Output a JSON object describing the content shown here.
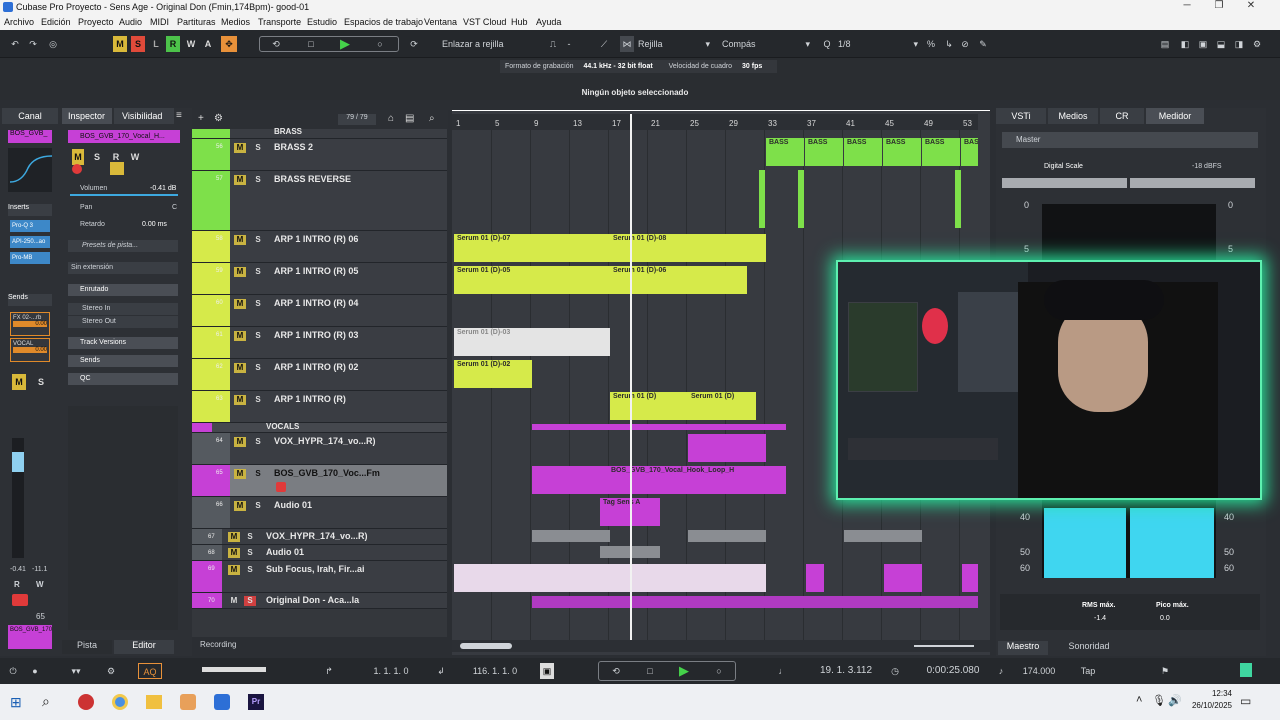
{
  "window": {
    "title": "Cubase Pro Proyecto - Sens Age - Original Don (Fmin,174Bpm)- good-01"
  },
  "menu": [
    "Archivo",
    "Edición",
    "Proyecto",
    "Audio",
    "MIDI",
    "Partituras",
    "Medios",
    "Transporte",
    "Estudio",
    "Espacios de trabajo",
    "Ventana",
    "VST Cloud",
    "Hub",
    "Ayuda"
  ],
  "toolbar": {
    "chips": [
      "M",
      "S",
      "L",
      "R",
      "W",
      "A"
    ],
    "snap_mode": "Enlazar a rejilla",
    "grid_type": "Rejilla",
    "grid_unit": "Compás",
    "quantize": "1/8",
    "dash": "-"
  },
  "infobar": {
    "format_label": "Formato de grabación",
    "format_value": "44.1 kHz - 32 bit float",
    "fps_label": "Velocidad de cuadro",
    "fps_value": "30 fps",
    "selection": "Ningún objeto seleccionado"
  },
  "left": {
    "tab_canal": "Canal",
    "tab_inspector": "Inspector",
    "tab_visibilidad": "Visibilidad",
    "channel_name": "BOS_GVB_",
    "track_name": "BOS_GVB_170_Vocal_H...",
    "volume_label": "Volumen",
    "volume_value": "-0.41 dB",
    "pan_label": "Pan",
    "pan_value": "C",
    "delay_label": "Retardo",
    "delay_value": "0.00 ms",
    "preset": "Presets de pista...",
    "extension": "Sin extensión",
    "routing": "Enrutado",
    "stereo_in": "Stereo In",
    "stereo_out": "Stereo Out",
    "track_versions": "Track Versions",
    "sends": "Sends",
    "qc": "QC",
    "inserts": "Inserts",
    "insert_slots": [
      "Pro-Q 3",
      "API-250...ao",
      "Pro-MB"
    ],
    "sends_title": "Sends",
    "send_slots": [
      {
        "name": "FX 02-...rb",
        "value": "0.00"
      },
      {
        "name": "VOCAL",
        "value": "0.00"
      }
    ],
    "fader_value1": "-0.41",
    "fader_value2": "-11.1",
    "fader_num": "65",
    "bottom_name": "BOS_GVB_170_Vocal_H",
    "tab_pista": "Pista",
    "tab_editor": "Editor"
  },
  "tracklist": {
    "counter": "79 / 79",
    "footer": "Recording",
    "tracks": [
      {
        "num": "",
        "name": "BRASS",
        "color": "#7ee04a"
      },
      {
        "num": "56",
        "name": "BRASS 2",
        "color": "#7ee04a"
      },
      {
        "num": "57",
        "name": "BRASS REVERSE",
        "color": "#7ee04a"
      },
      {
        "num": "58",
        "name": "ARP 1 INTRO (R) 06",
        "color": "#d6ea4a"
      },
      {
        "num": "59",
        "name": "ARP 1 INTRO (R) 05",
        "color": "#d6ea4a"
      },
      {
        "num": "60",
        "name": "ARP 1 INTRO (R) 04",
        "color": "#d6ea4a"
      },
      {
        "num": "61",
        "name": "ARP 1 INTRO (R) 03",
        "color": "#d6ea4a"
      },
      {
        "num": "62",
        "name": "ARP 1 INTRO (R) 02",
        "color": "#d6ea4a"
      },
      {
        "num": "63",
        "name": "ARP 1 INTRO (R)",
        "color": "#d6ea4a"
      },
      {
        "num": "",
        "name": "VOCALS",
        "color": "#c640d6"
      },
      {
        "num": "64",
        "name": "VOX_HYPR_174_vo...R)",
        "color": "#555a60"
      },
      {
        "num": "65",
        "name": "BOS_GVB_170_Voc...Fm",
        "color": "#c640d6"
      },
      {
        "num": "66",
        "name": "Audio 01",
        "color": "#555a60"
      },
      {
        "num": "67",
        "name": "VOX_HYPR_174_vo...R)",
        "color": "#555a60"
      },
      {
        "num": "68",
        "name": "Audio 01",
        "color": "#555a60"
      },
      {
        "num": "69",
        "name": "Sub Focus, Irah, Fir...ai",
        "color": "#c640d6"
      },
      {
        "num": "70",
        "name": "Original Don - Aca...la",
        "color": "#c640d6"
      }
    ]
  },
  "ruler": [
    "1",
    "5",
    "9",
    "13",
    "17",
    "21",
    "25",
    "29",
    "33",
    "37",
    "41",
    "45",
    "49",
    "53"
  ],
  "events": [
    {
      "label": "BASS",
      "color": "#7ee04a"
    },
    {
      "label": "BASS",
      "color": "#7ee04a"
    },
    {
      "label": "BASS",
      "color": "#7ee04a"
    },
    {
      "label": "BASS",
      "color": "#7ee04a"
    },
    {
      "label": "BASS",
      "color": "#7ee04a"
    },
    {
      "label": "BASS",
      "color": "#7ee04a"
    },
    {
      "label": "Serum 01 (D)-07",
      "color": "#d6ea4a"
    },
    {
      "label": "Serum 01 (D)-08",
      "color": "#d6ea4a"
    },
    {
      "label": "Serum 01 (D)-05",
      "color": "#d6ea4a"
    },
    {
      "label": "Serum 01 (D)-06",
      "color": "#d6ea4a"
    },
    {
      "label": "Serum 01 (D)-03",
      "color": "#e4e4e4"
    },
    {
      "label": "Serum 01 (D)-02",
      "color": "#d6ea4a"
    },
    {
      "label": "Serum 01 (D)",
      "color": "#d6ea4a"
    },
    {
      "label": "Serum 01 (D)",
      "color": "#d6ea4a"
    },
    {
      "label": "BOS_GVB_170_Vocal_Hook_Loop_H",
      "color": "#c640d6"
    },
    {
      "label": "Tag Sens A",
      "color": "#c640d6"
    }
  ],
  "right": {
    "tabs": [
      "VSTi",
      "Medios",
      "CR",
      "Medidor"
    ],
    "master": "Master",
    "scale_label": "Digital Scale",
    "scale_value": "-18 dBFS",
    "meter_labels": [
      "0",
      "5",
      "40",
      "50",
      "60"
    ],
    "rms_label": "RMS máx.",
    "rms_value": "-1.4",
    "peak_label": "Pico máx.",
    "peak_value": "0.0",
    "tab_maestro": "Maestro",
    "tab_sonoridad": "Sonoridad"
  },
  "transport": {
    "aq": "AQ",
    "left_pos": "1. 1. 1. 0",
    "right_pos": "116. 1. 1. 0",
    "position": "19. 1. 3.112",
    "time": "0:00:25.080",
    "tempo": "174.000",
    "tap": "Tap"
  },
  "taskbar": {
    "clock": "12:34",
    "date": "26/10/2025"
  }
}
